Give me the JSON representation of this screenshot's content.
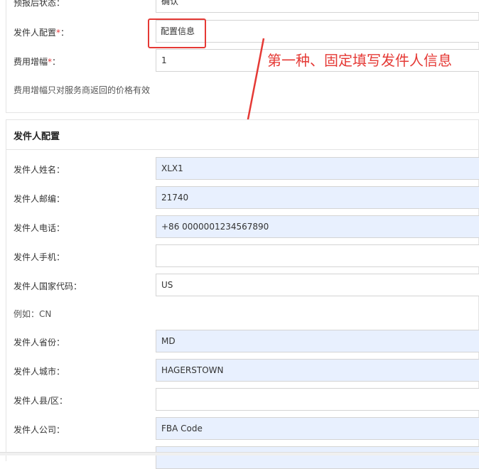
{
  "top": {
    "status_label": "预报后状态：",
    "status_value": "确认",
    "sender_config_label": "发件人配置",
    "sender_config_suffix": "：",
    "sender_config_value": "配置信息",
    "fee_label": "费用增幅",
    "fee_suffix": "：",
    "fee_value": "1",
    "fee_hint": "费用增幅只对服务商返回的价格有效",
    "required_mark": "*"
  },
  "annotation": {
    "text": "第一种、固定填写发件人信息",
    "color": "#e53935"
  },
  "section": {
    "title": "发件人配置"
  },
  "fields": [
    {
      "label": "发件人姓名：",
      "value": "XLX1",
      "filled": true
    },
    {
      "label": "发件人邮编：",
      "value": "21740",
      "filled": true
    },
    {
      "label": "发件人电话：",
      "value": "+86 0000001234567890",
      "filled": true
    },
    {
      "label": "发件人手机：",
      "value": "",
      "filled": false
    },
    {
      "label": "发件人国家代码：",
      "value": "US",
      "filled": false
    },
    {
      "label": "发件人省份：",
      "value": "MD",
      "filled": true
    },
    {
      "label": "发件人城市：",
      "value": "HAGERSTOWN",
      "filled": true
    },
    {
      "label": "发件人县/区：",
      "value": "",
      "filled": false
    },
    {
      "label": "发件人公司：",
      "value": "FBA Code",
      "filled": true
    }
  ],
  "country_hint": "例如：CN",
  "colors": {
    "accent_red": "#e53935",
    "filled_bg": "#e8f0fe"
  }
}
